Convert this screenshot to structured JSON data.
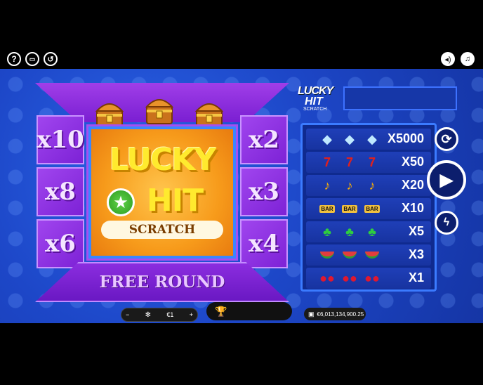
{
  "topbar": {
    "help_icon": "question-icon",
    "paytable_icon": "book-icon",
    "history_icon": "history-icon",
    "sound_icon": "speaker-icon",
    "music_icon": "music-note-icon"
  },
  "board": {
    "title_line1": "LUCKY",
    "title_line2": "HIT",
    "subtitle": "SCRATCH",
    "footer": "FREE ROUND",
    "left_multipliers": [
      "x10",
      "x8",
      "x6"
    ],
    "right_multipliers": [
      "x2",
      "x3",
      "x4"
    ]
  },
  "right_logo": {
    "line1": "LUCKY",
    "line2": "HIT",
    "line3": "SCRATCH"
  },
  "paytable": [
    {
      "symbol": "diamond",
      "glyph": "💎",
      "multiplier": "X5000"
    },
    {
      "symbol": "seven",
      "glyph": "7",
      "multiplier": "X50"
    },
    {
      "symbol": "bell",
      "glyph": "🔔",
      "multiplier": "X20"
    },
    {
      "symbol": "bar",
      "glyph": "BAR",
      "multiplier": "X10"
    },
    {
      "symbol": "clover",
      "glyph": "♣",
      "multiplier": "X5"
    },
    {
      "symbol": "watermelon",
      "glyph": "🍉",
      "multiplier": "X3"
    },
    {
      "symbol": "cherry",
      "glyph": "🍒",
      "multiplier": "X1"
    }
  ],
  "controls": {
    "autoplay_icon": "refresh-icon",
    "play_icon": "play-icon",
    "turbo_icon": "lightning-icon"
  },
  "bottom": {
    "bet_minus": "−",
    "bet_value": "€1",
    "bet_plus": "+",
    "trophy_icon": "trophy-icon",
    "balance": "€6,013,134,900.25"
  },
  "colors": {
    "background": "#1d47c8",
    "board_purple": "#8a2ee0",
    "logo_yellow": "#ffea2e",
    "center_orange": "#f79b1b"
  }
}
